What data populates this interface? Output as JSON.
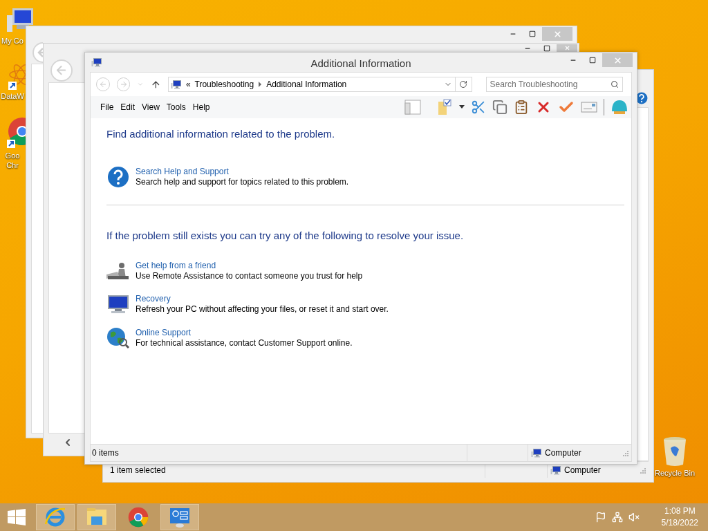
{
  "desktop_icons": [
    {
      "kind": "computer",
      "label": "My Co"
    },
    {
      "kind": "atom",
      "label": "DataW"
    },
    {
      "kind": "chrome",
      "label": "Goo Chr"
    }
  ],
  "recycle_bin": {
    "label": "Recycle Bin"
  },
  "back_window": {
    "status_bar": {
      "selection": "1 item selected",
      "zone": "Computer"
    }
  },
  "window": {
    "title": "Additional Information",
    "address": {
      "overflow": "«",
      "crumbs": [
        "Troubleshooting",
        "Additional Information"
      ]
    },
    "search": {
      "placeholder": "Search Troubleshooting"
    },
    "menu": [
      "File",
      "Edit",
      "View",
      "Tools",
      "Help"
    ],
    "sections": [
      {
        "heading": "Find additional information related to the problem.",
        "items": [
          {
            "kind": "help",
            "title": "Search Help and Support",
            "description": "Search help and support for topics related to this problem."
          }
        ]
      },
      {
        "heading": "If the problem still exists you can try any of the following to resolve your issue.",
        "items": [
          {
            "kind": "remote",
            "title": "Get help from a friend",
            "description": "Use Remote Assistance to contact someone you trust for help"
          },
          {
            "kind": "recovery",
            "title": "Recovery",
            "description": "Refresh your PC without affecting your files, or reset it and start over."
          },
          {
            "kind": "online",
            "title": "Online Support",
            "description": "For technical assistance, contact Customer Support online."
          }
        ]
      }
    ],
    "status_bar": {
      "items": "0 items",
      "zone": "Computer"
    }
  },
  "taskbar": {
    "buttons": [
      {
        "kind": "ie",
        "open": true
      },
      {
        "kind": "explorer",
        "open": true
      },
      {
        "kind": "chrome",
        "open": false
      },
      {
        "kind": "control_panel",
        "open": true
      }
    ],
    "tray": {
      "time": "1:08 PM",
      "date": "5/18/2022"
    }
  }
}
